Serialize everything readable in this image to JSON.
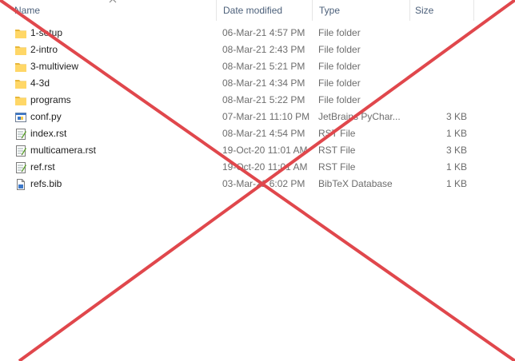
{
  "columns": {
    "name": "Name",
    "date": "Date modified",
    "type": "Type",
    "size": "Size"
  },
  "sort": {
    "column": "name",
    "icon": "sort-up-icon"
  },
  "files": [
    {
      "name": "1-setup",
      "date": "06-Mar-21 4:57 PM",
      "type": "File folder",
      "size": "",
      "icon": "folder-icon"
    },
    {
      "name": "2-intro",
      "date": "08-Mar-21 2:43 PM",
      "type": "File folder",
      "size": "",
      "icon": "folder-icon"
    },
    {
      "name": "3-multiview",
      "date": "08-Mar-21 5:21 PM",
      "type": "File folder",
      "size": "",
      "icon": "folder-icon"
    },
    {
      "name": "4-3d",
      "date": "08-Mar-21 4:34 PM",
      "type": "File folder",
      "size": "",
      "icon": "folder-icon"
    },
    {
      "name": "programs",
      "date": "08-Mar-21 5:22 PM",
      "type": "File folder",
      "size": "",
      "icon": "folder-icon"
    },
    {
      "name": "conf.py",
      "date": "07-Mar-21 11:10 PM",
      "type": "JetBrains PyChar...",
      "size": "3 KB",
      "icon": "python-file-icon"
    },
    {
      "name": "index.rst",
      "date": "08-Mar-21 4:54 PM",
      "type": "RST File",
      "size": "1 KB",
      "icon": "rst-file-icon"
    },
    {
      "name": "multicamera.rst",
      "date": "19-Oct-20 11:01 AM",
      "type": "RST File",
      "size": "3 KB",
      "icon": "rst-file-icon"
    },
    {
      "name": "ref.rst",
      "date": "19-Oct-20 11:01 AM",
      "type": "RST File",
      "size": "1 KB",
      "icon": "rst-file-icon"
    },
    {
      "name": "refs.bib",
      "date": "03-Mar-21 6:02 PM",
      "type": "BibTeX Database",
      "size": "1 KB",
      "icon": "bib-file-icon"
    }
  ],
  "overlay": {
    "icon": "red-cross-icon",
    "color": "#e0474c"
  },
  "colors": {
    "folder": "#ffd767",
    "folder_dark": "#e8b73a",
    "header_text": "#4c607a"
  }
}
